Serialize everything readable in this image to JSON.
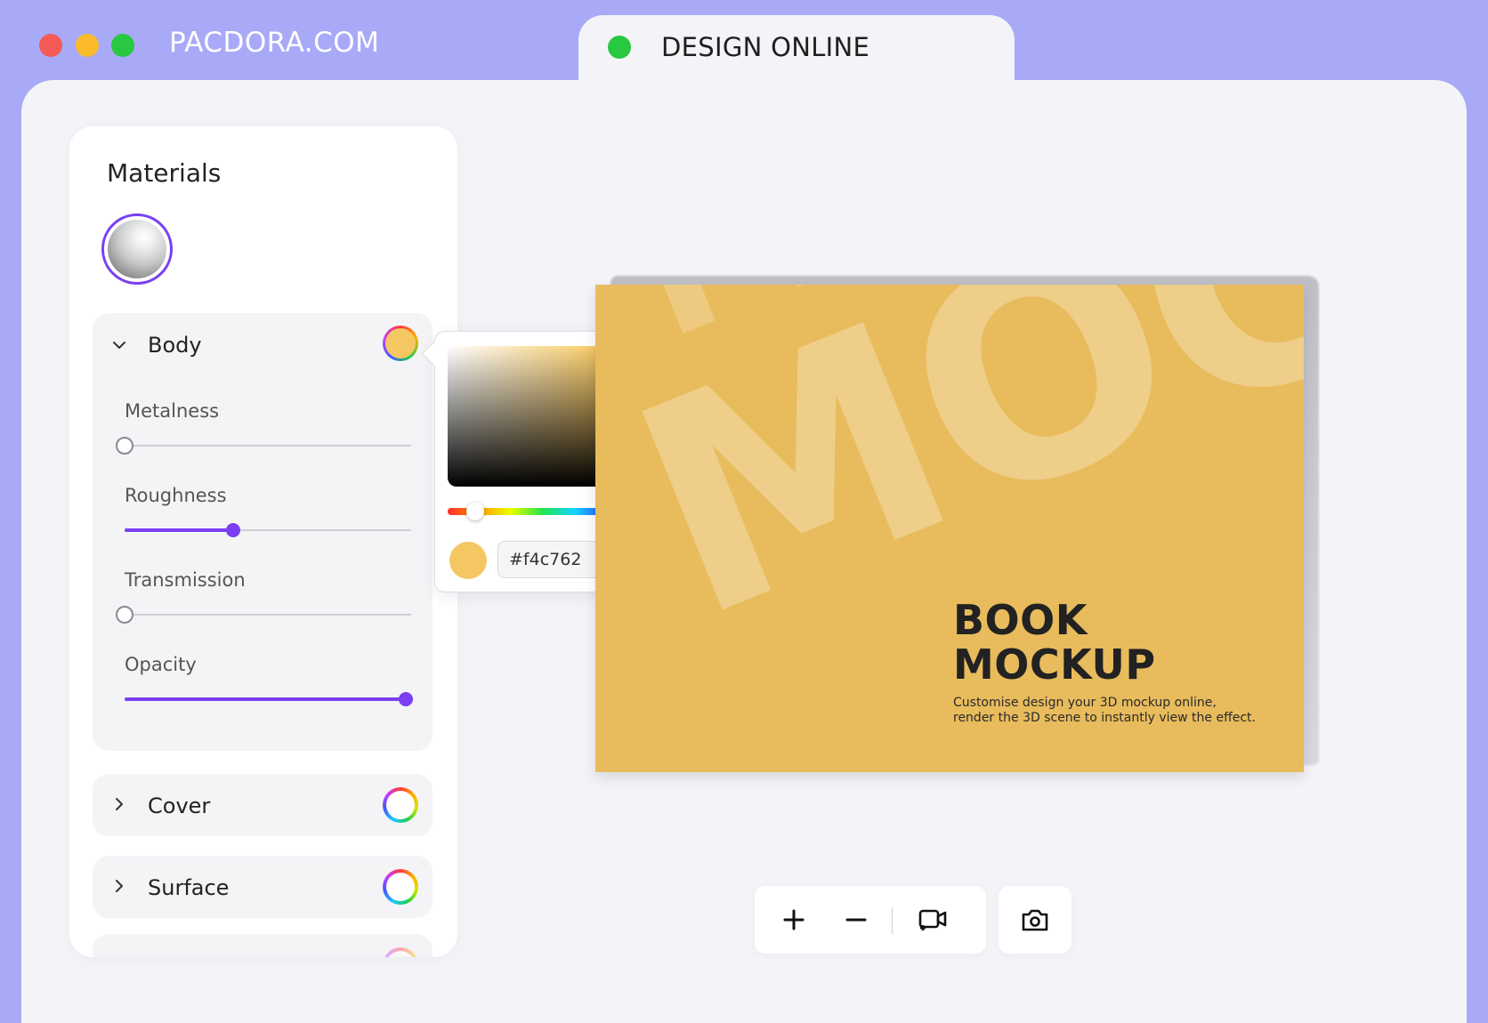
{
  "window": {
    "traffic_lights": [
      "#f45b57",
      "#fbbb2a",
      "#28c840"
    ],
    "brand": "PACDORA.COM"
  },
  "tab": {
    "label": "DESIGN ONLINE",
    "dot_color": "#28c840"
  },
  "materials": {
    "title": "Materials",
    "sections": {
      "body": {
        "label": "Body",
        "expanded": true,
        "swatch_color": "#f4c762"
      },
      "cover": {
        "label": "Cover",
        "expanded": false
      },
      "surface": {
        "label": "Surface",
        "expanded": false
      }
    },
    "sliders": [
      {
        "label": "Metalness",
        "value": 0
      },
      {
        "label": "Roughness",
        "value": 0.38
      },
      {
        "label": "Transmission",
        "value": 0
      },
      {
        "label": "Opacity",
        "value": 1
      }
    ]
  },
  "color_picker": {
    "hex": "#f4c762",
    "swatch_color": "#f4c762",
    "hue_position": 0.11,
    "sv_cursor": {
      "saturation": 0.64,
      "value": 0.96
    }
  },
  "book": {
    "cover_color": "#e8bb5c",
    "title_line1": "BOOK",
    "title_line2": "MOCKUP",
    "subtitle": "Customise design your 3D mockup online, render the 3D scene to instantly view the effect.",
    "background_word": "MOCKUP"
  },
  "toolbar": {
    "zoom_in_icon": "plus-icon",
    "zoom_out_icon": "minus-icon",
    "camera_view_icon": "video-camera-icon",
    "screenshot_icon": "camera-icon"
  },
  "colors": {
    "accent": "#7a3ff2",
    "background": "#a8aaf7",
    "surface": "#f4f4f8"
  }
}
